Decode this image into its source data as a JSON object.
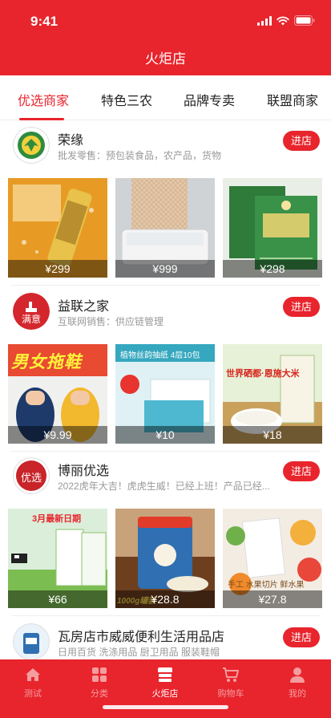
{
  "status_bar": {
    "time": "9:41"
  },
  "header": {
    "title": "火炬店"
  },
  "tabs": [
    {
      "label": "优选商家",
      "active": true
    },
    {
      "label": "特色三农",
      "active": false
    },
    {
      "label": "品牌专卖",
      "active": false
    },
    {
      "label": "联盟商家",
      "active": false
    }
  ],
  "shops": [
    {
      "name": "荣缘",
      "desc": "批发零售：预包装食品，农产品，货物",
      "enter_label": "进店",
      "products": [
        {
          "price": "¥299"
        },
        {
          "price": "¥999"
        },
        {
          "price": "¥298"
        }
      ]
    },
    {
      "name": "益联之家",
      "logo_text": "满意",
      "desc": "互联网销售：供应链管理",
      "enter_label": "进店",
      "products": [
        {
          "price": "¥9.99",
          "text": "男女拖鞋"
        },
        {
          "price": "¥10",
          "text": "植物丝韵抽纸 4层10包"
        },
        {
          "price": "¥18",
          "text": "世界硒都·恩施大米"
        }
      ]
    },
    {
      "name": "博丽优选",
      "logo_text": "优选",
      "desc": "2022虎年大吉！虎虎生威！已经上班！产品已经...",
      "enter_label": "进店",
      "products": [
        {
          "price": "¥66",
          "text": "3月最新日期"
        },
        {
          "price": "¥28.8",
          "text": "1000g罐装"
        },
        {
          "price": "¥27.8",
          "text": "手工 水果切片 鲜水果"
        }
      ]
    },
    {
      "name": "瓦房店市威威便利生活用品店",
      "desc": "日用百货 洗涤用品 厨卫用品 服装鞋帽",
      "enter_label": "进店"
    }
  ],
  "bottom_nav": [
    {
      "label": "测试",
      "icon": "home-icon",
      "active": false
    },
    {
      "label": "分类",
      "icon": "category-icon",
      "active": false
    },
    {
      "label": "火炬店",
      "icon": "store-icon",
      "active": true
    },
    {
      "label": "购物车",
      "icon": "cart-icon",
      "active": false
    },
    {
      "label": "我的",
      "icon": "user-icon",
      "active": false
    }
  ],
  "colors": {
    "brand": "#e8242c",
    "text": "#222222",
    "muted": "#999999"
  }
}
